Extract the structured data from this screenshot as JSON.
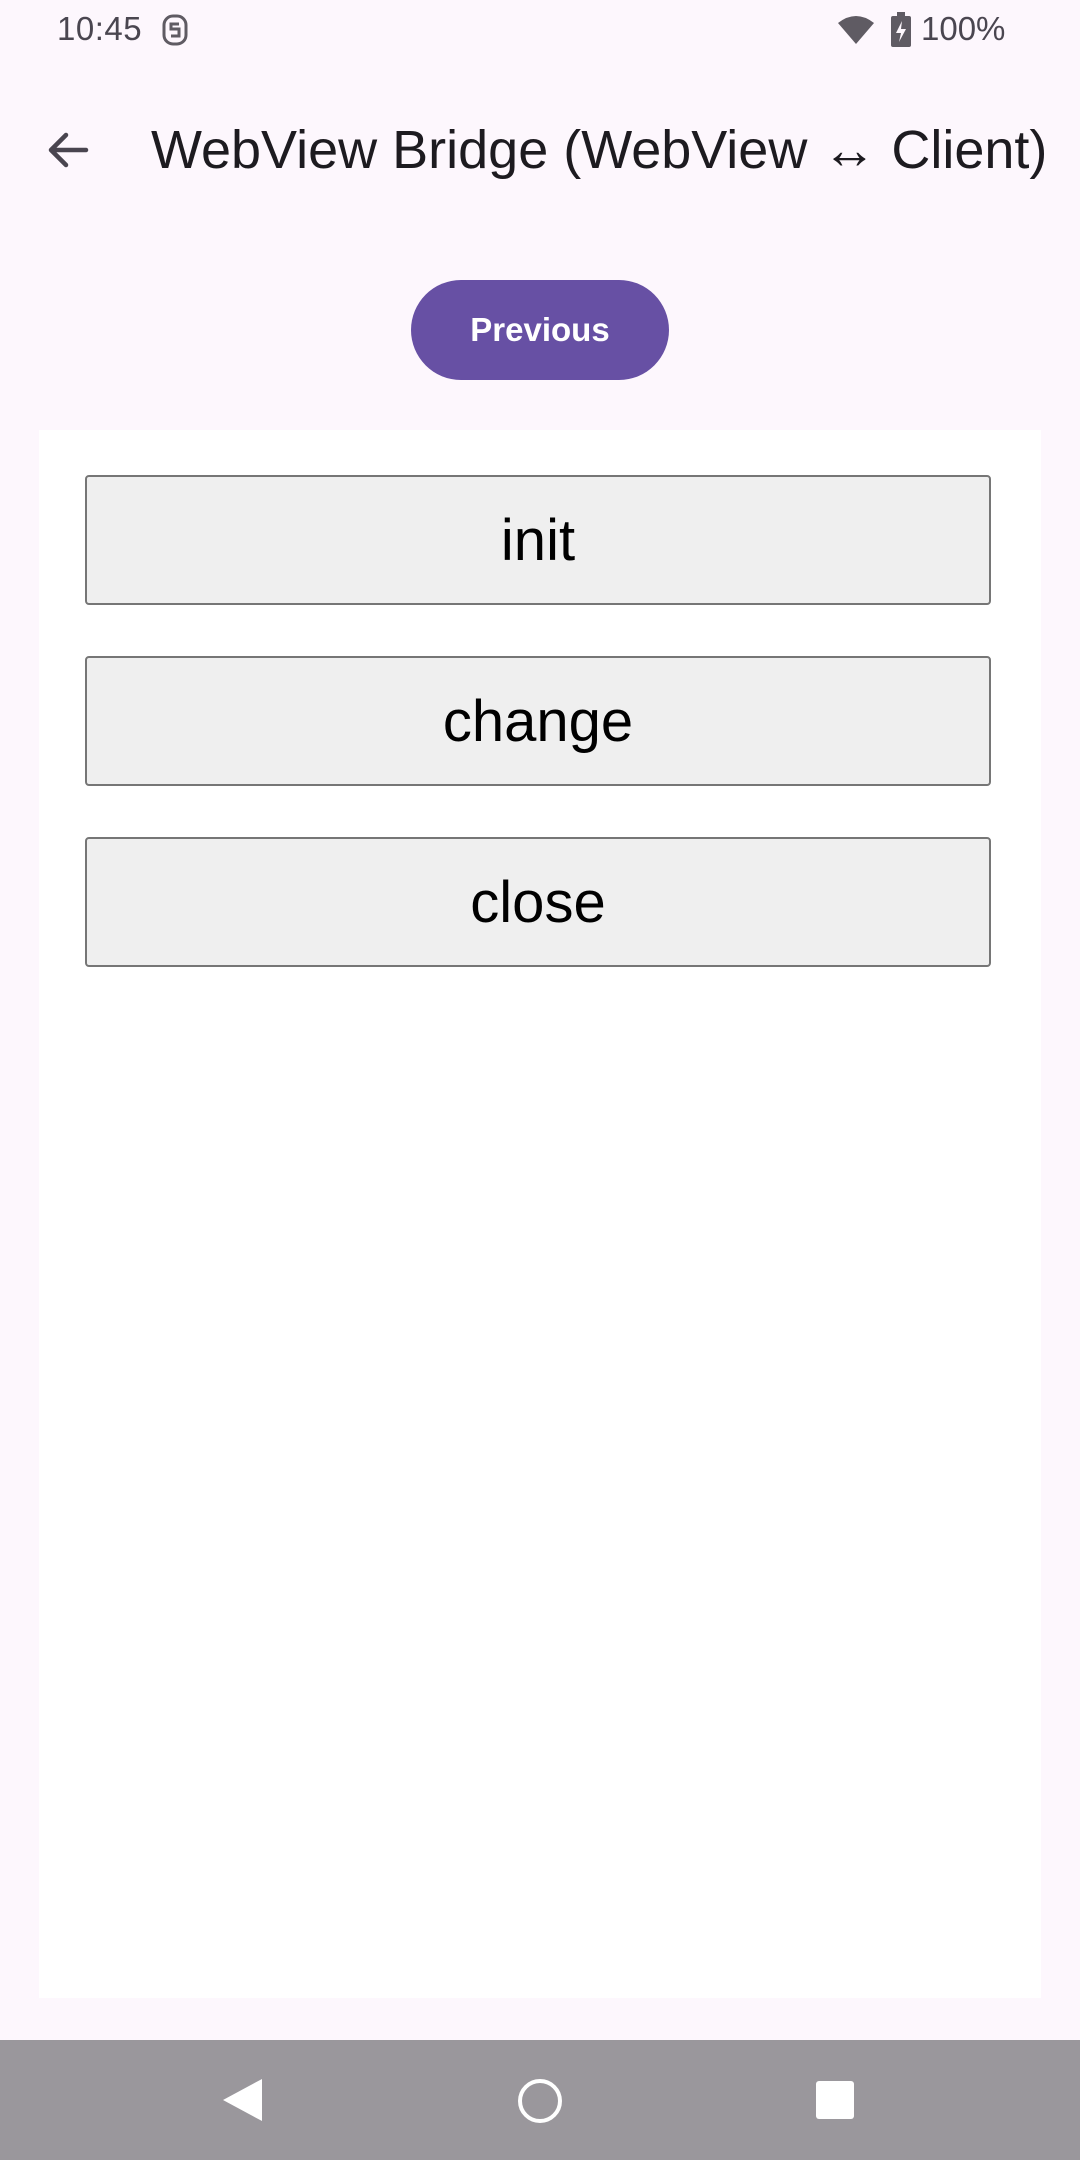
{
  "status_bar": {
    "time": "10:45",
    "battery": "100%",
    "icons": [
      "s-notification-icon",
      "wifi-icon",
      "battery-charging-icon"
    ]
  },
  "app_bar": {
    "title": "WebView Bridge (WebView ↔ Client)",
    "back_icon": "arrow-back-icon"
  },
  "controls": {
    "previous_label": "Previous"
  },
  "webview": {
    "buttons": [
      {
        "label": "init"
      },
      {
        "label": "change"
      },
      {
        "label": "close"
      }
    ]
  },
  "nav_bar": {
    "icons": [
      "nav-back-icon",
      "nav-home-icon",
      "nav-recents-icon"
    ]
  },
  "colors": {
    "background": "#fdf7fd",
    "primary": "#6750a4",
    "webview_bg": "#ffffff",
    "web_button_bg": "#efefef",
    "web_button_border": "#767676",
    "nav_bar": "#9a979c"
  }
}
